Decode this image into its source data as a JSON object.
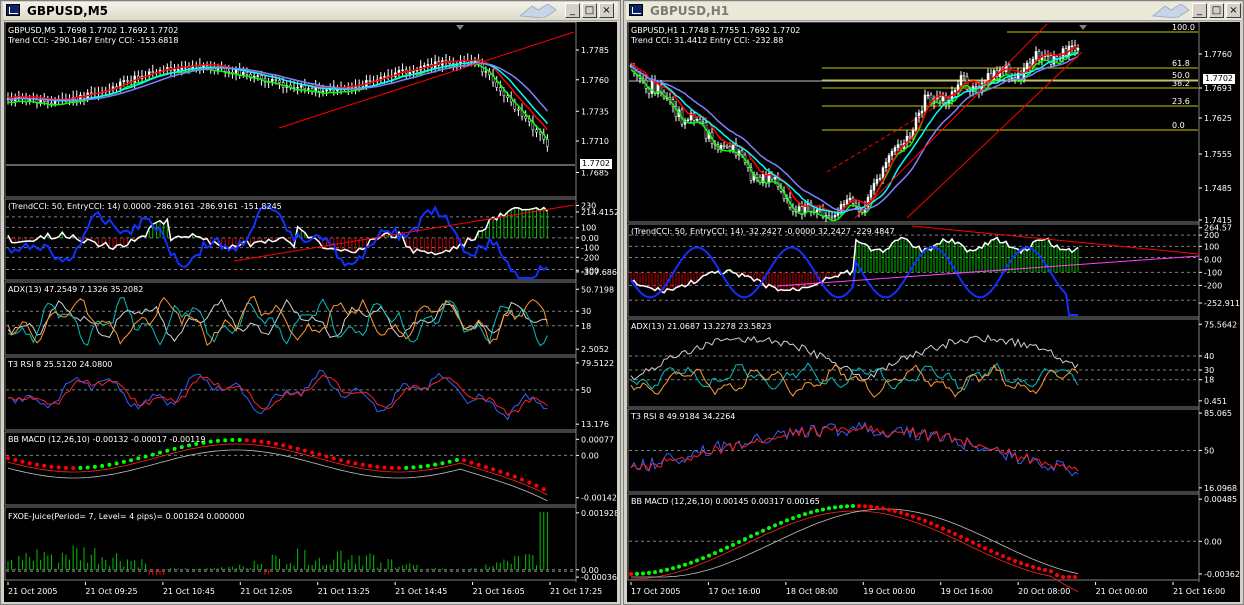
{
  "left": {
    "title": "GBPUSD,M5",
    "panes": [
      {
        "line1": "GBPUSD,M5  1.7698 1.7702 1.7692 1.7702",
        "line2": "Trend CCI: -290.1467 Entry CCI: -153.6818",
        "axis": [
          "1.7785",
          "1.7760",
          "1.7735",
          "1.7710",
          "1.7685"
        ],
        "price_box": "1.7702"
      },
      {
        "label": "(TrendCCI: 50, EntryCCI: 14) 0.0000 -286.9161 -286.9161 -151.8245",
        "axis": [
          "230",
          "214.4152",
          "100",
          "0.00",
          "-100",
          "-200",
          "-307.686",
          "-300"
        ]
      },
      {
        "label": "ADX(13) 47.2549 7.1326 35.2082",
        "axis": [
          "50.7198",
          "30",
          "18",
          "2.5052"
        ]
      },
      {
        "label": "T3 RSI 8 25.5120 24.0800",
        "axis": [
          "79.5122",
          "50",
          "13.176"
        ]
      },
      {
        "label": "BB MACD (12,26,10) -0.00132 -0.00017 -0.00119",
        "axis": [
          "0.00077",
          "0.00",
          "-0.00142"
        ]
      },
      {
        "label": "FXOE-Juice(Period= 7, Level= 4 pips)=  0.001824 0.000000",
        "axis": [
          "0.001928",
          "0.00",
          "-0.00036"
        ]
      }
    ],
    "time_labels": [
      "21 Oct 2005",
      "21 Oct 09:25",
      "21 Oct 10:45",
      "21 Oct 12:05",
      "21 Oct 13:25",
      "21 Oct 14:45",
      "21 Oct 16:05",
      "21 Oct 17:25"
    ]
  },
  "right": {
    "title": "GBPUSD,H1",
    "panes": [
      {
        "line1": "GBPUSD,H1  1.7748 1.7755 1.7692 1.7702",
        "line2": "Trend CCI: 31.4412 Entry CCI: -232.88",
        "axis": [
          "1.7760",
          "1.7693",
          "1.7625",
          "1.7555",
          "1.7485",
          "1.7415"
        ],
        "price_box": "1.7702",
        "fib": [
          "100.0",
          "61.8",
          "50.0",
          "38.2",
          "23.6",
          "0.0"
        ]
      },
      {
        "label": "(TrendCCI: 50, EntryCCI: 14) -32.2427 -0.0000 32.2427 -229.4847",
        "axis": [
          "264.57",
          "200",
          "100",
          "0.00",
          "-100",
          "-200",
          "-252.911"
        ]
      },
      {
        "label": "ADX(13) 21.0687 13.2278 23.5823",
        "axis": [
          "75.5642",
          "40",
          "30",
          "18",
          "0.451"
        ]
      },
      {
        "label": "T3 RSI 8 49.9184 34.2264",
        "axis": [
          "85.065",
          "50",
          "16.0968"
        ]
      },
      {
        "label": "BB MACD (12,26,10) 0.00145 0.00317 0.00165",
        "axis": [
          "0.00485",
          "0.00",
          "-0.00362"
        ]
      }
    ],
    "time_labels": [
      "17 Oct 2005",
      "17 Oct 16:00",
      "18 Oct 08:00",
      "19 Oct 00:00",
      "19 Oct 16:00",
      "20 Oct 08:00",
      "21 Oct 00:00",
      "21 Oct 16:00"
    ]
  },
  "buttons": {
    "minimize": "_",
    "maximize": "□",
    "close": "×"
  },
  "colors": {
    "background": "#000000",
    "bull": "#00ff00",
    "bear": "#ff0000",
    "grid": "#808080",
    "trendline": "#ff0000"
  }
}
